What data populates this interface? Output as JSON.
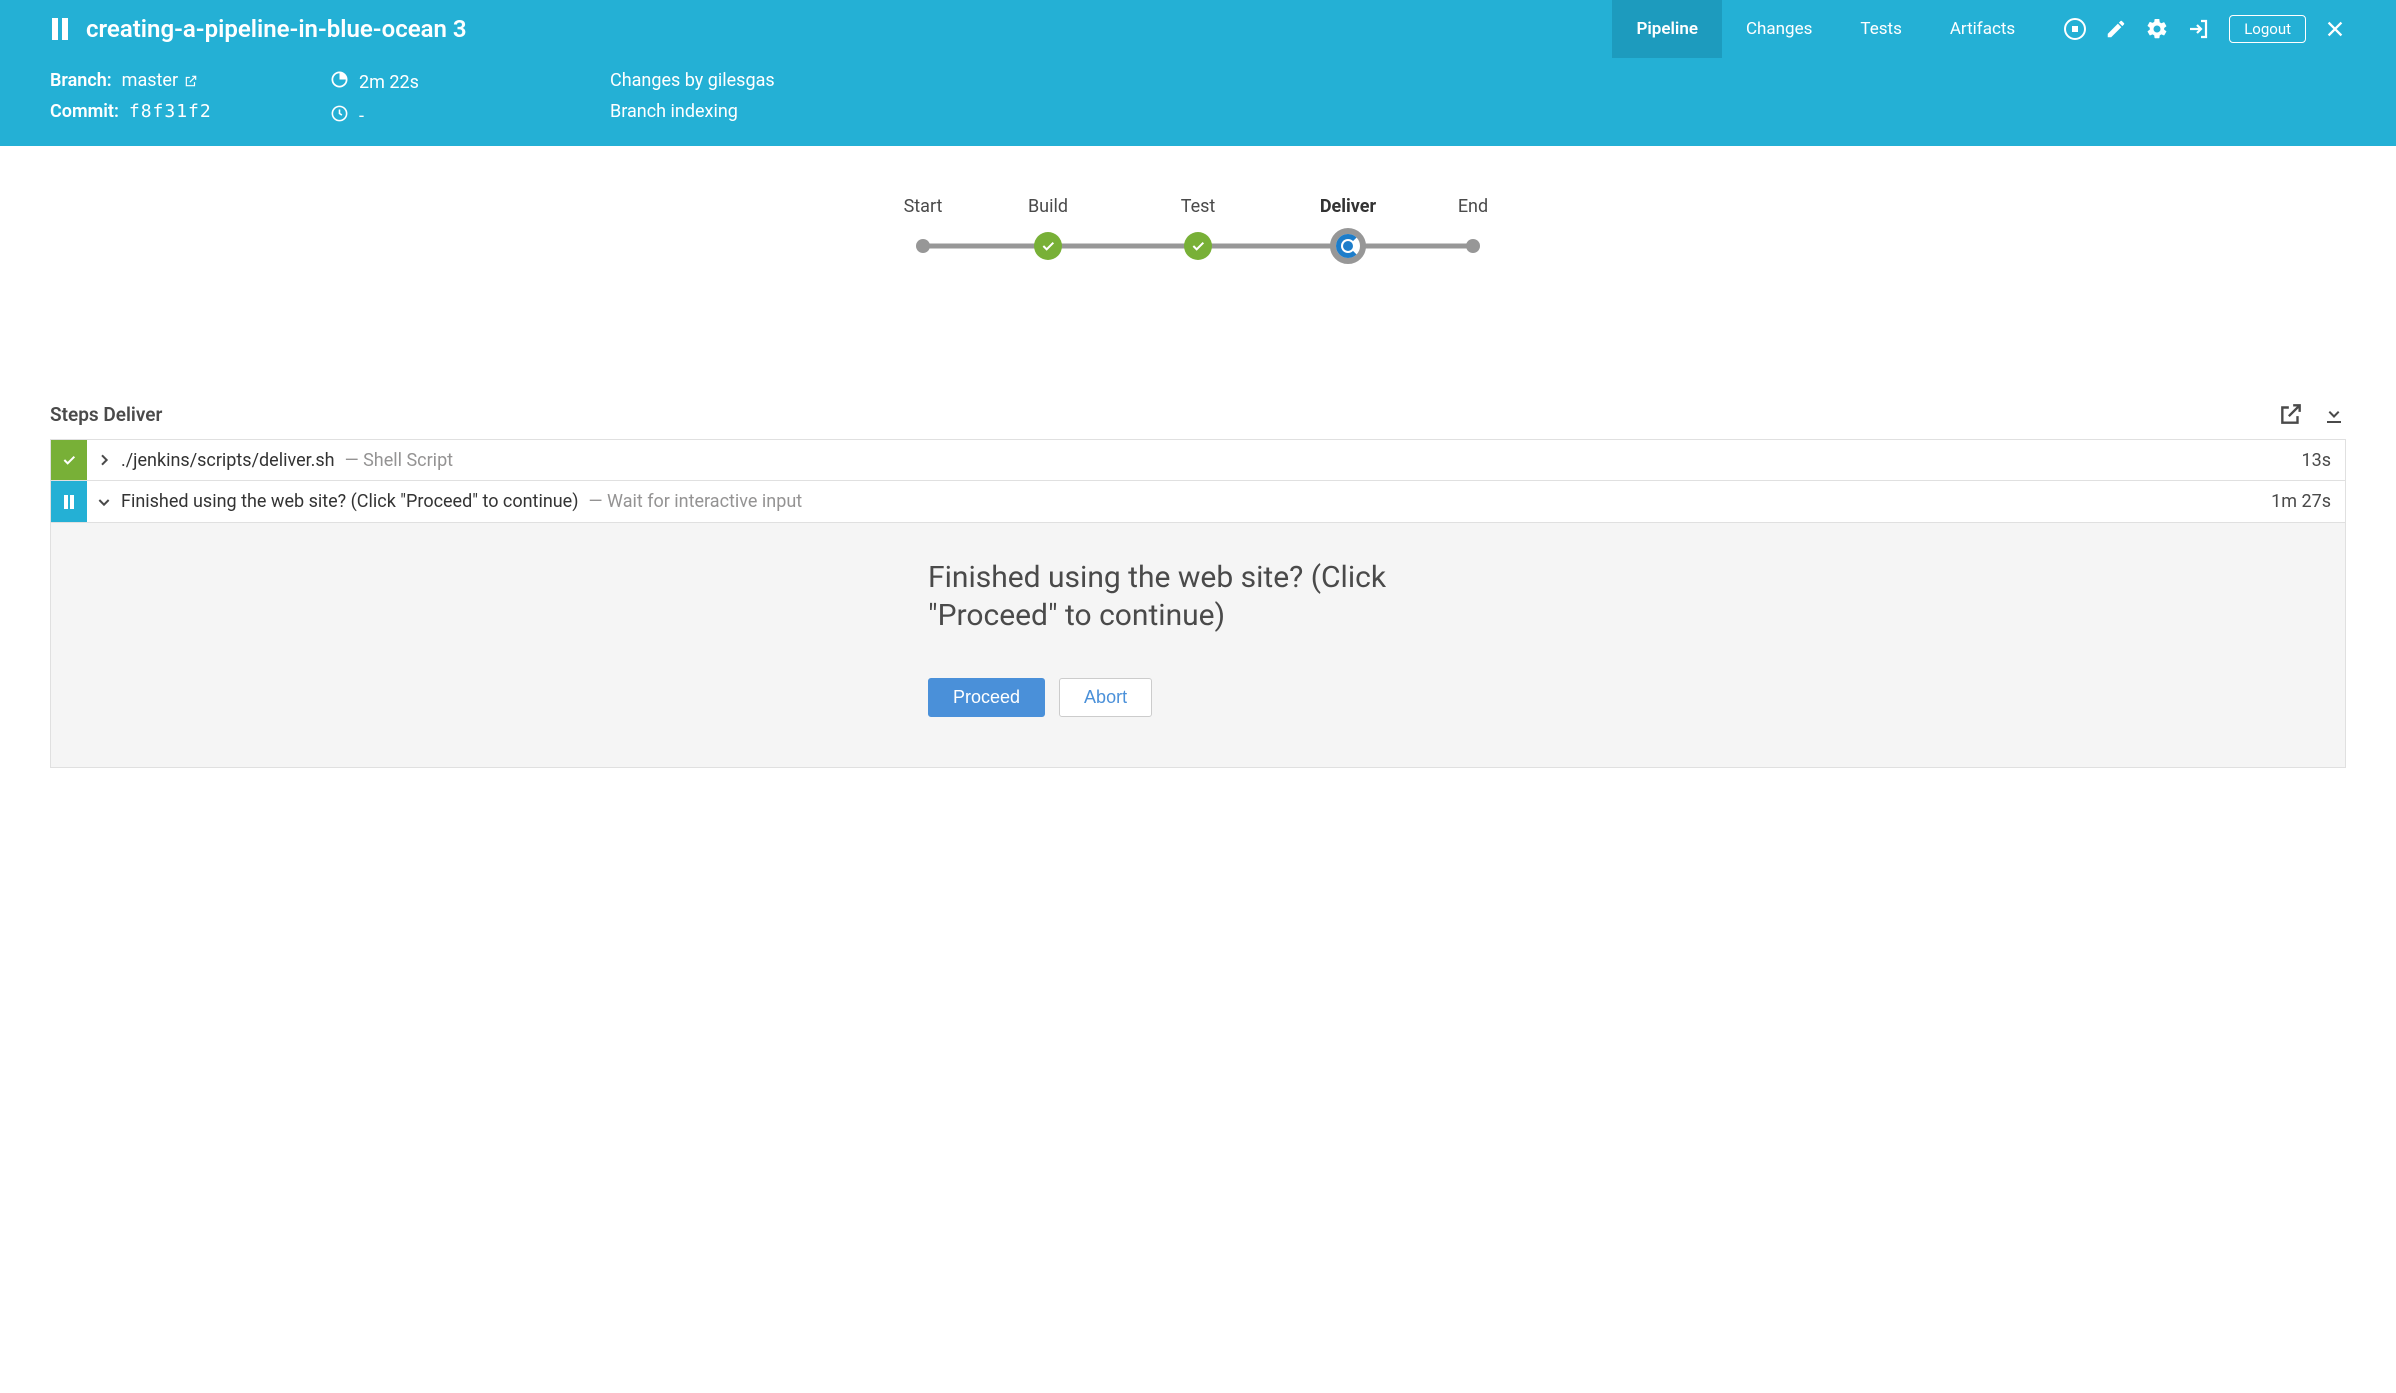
{
  "header": {
    "title": "creating-a-pipeline-in-blue-ocean 3",
    "tabs": {
      "pipeline": "Pipeline",
      "changes": "Changes",
      "tests": "Tests",
      "artifacts": "Artifacts"
    },
    "logout": "Logout"
  },
  "meta": {
    "branch_label": "Branch:",
    "branch_value": "master",
    "commit_label": "Commit:",
    "commit_value": "f8f31f2",
    "duration": "2m 22s",
    "time": "-",
    "changes_by": "Changes by gilesgas",
    "cause": "Branch indexing"
  },
  "pipeline": {
    "stages": {
      "start": "Start",
      "build": "Build",
      "test": "Test",
      "deliver": "Deliver",
      "end": "End"
    }
  },
  "steps": {
    "heading": "Steps Deliver",
    "row1": {
      "cmd": "./jenkins/scripts/deliver.sh",
      "type": "— Shell Script",
      "dur": "13s"
    },
    "row2": {
      "cmd": "Finished using the web site? (Click \"Proceed\" to continue)",
      "type": "— Wait for interactive input",
      "dur": "1m 27s"
    }
  },
  "input": {
    "message": "Finished using the web site? (Click \"Proceed\" to continue)",
    "proceed": "Proceed",
    "abort": "Abort"
  }
}
